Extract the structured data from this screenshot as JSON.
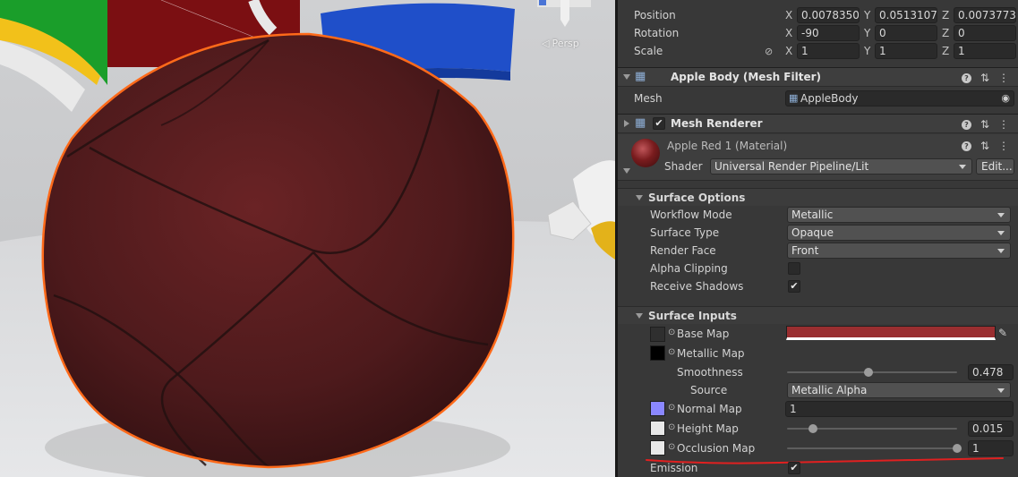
{
  "scene": {
    "view_label": "Persp"
  },
  "transform": {
    "position": {
      "label": "Position",
      "x": "0.0078350",
      "y": "0.0513107",
      "z": "0.0073773"
    },
    "rotation": {
      "label": "Rotation",
      "x": "-90",
      "y": "0",
      "z": "0"
    },
    "scale": {
      "label": "Scale",
      "x": "1",
      "y": "1",
      "z": "1"
    },
    "axis_x": "X",
    "axis_y": "Y",
    "axis_z": "Z"
  },
  "mesh_filter": {
    "title": "Apple Body (Mesh Filter)",
    "mesh_label": "Mesh",
    "mesh_value": "AppleBody"
  },
  "mesh_renderer": {
    "title": "Mesh Renderer",
    "enabled": true
  },
  "material": {
    "name": "Apple Red 1 (Material)",
    "shader_label": "Shader",
    "shader_value": "Universal Render Pipeline/Lit",
    "edit_label": "Edit...",
    "preview_color": "#7a1c1e"
  },
  "surface_options": {
    "title": "Surface Options",
    "workflow_mode": {
      "label": "Workflow Mode",
      "value": "Metallic"
    },
    "surface_type": {
      "label": "Surface Type",
      "value": "Opaque"
    },
    "render_face": {
      "label": "Render Face",
      "value": "Front"
    },
    "alpha_clipping": {
      "label": "Alpha Clipping",
      "checked": false
    },
    "receive_shadows": {
      "label": "Receive Shadows",
      "checked": true
    }
  },
  "surface_inputs": {
    "title": "Surface Inputs",
    "base_map": {
      "label": "Base Map",
      "color": "#9a2e30"
    },
    "metallic_map": {
      "label": "Metallic Map",
      "swatch": "#000000"
    },
    "smoothness": {
      "label": "Smoothness",
      "value": "0.478",
      "fraction": 0.478
    },
    "source": {
      "label": "Source",
      "value": "Metallic Alpha"
    },
    "normal_map": {
      "label": "Normal Map",
      "value": "1",
      "swatch": "#8a87ff"
    },
    "height_map": {
      "label": "Height Map",
      "value": "0.015",
      "fraction": 0.15,
      "swatch": "#e8e8e8"
    },
    "occlusion_map": {
      "label": "Occlusion Map",
      "value": "1",
      "fraction": 1.0,
      "swatch": "#e8e8e8"
    },
    "emission": {
      "label": "Emission",
      "checked": true
    }
  },
  "colors": {
    "selection_outline": "#ff6a1a",
    "annotation_underline": "#e02020",
    "panel_bg": "#383838"
  }
}
